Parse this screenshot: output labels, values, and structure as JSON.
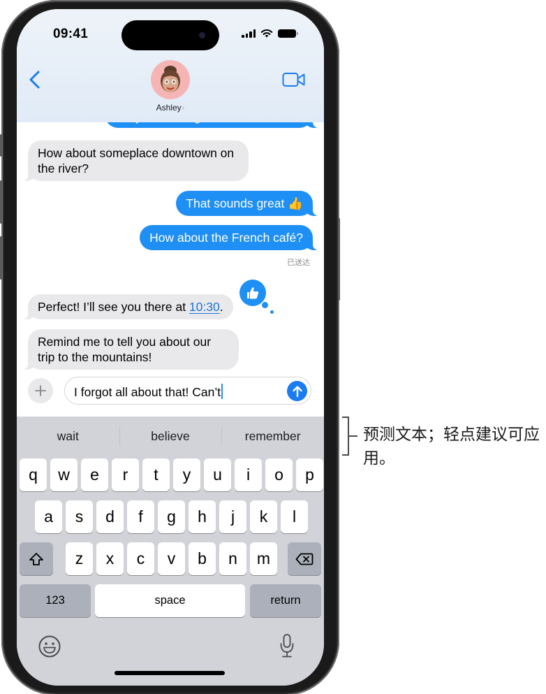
{
  "status_bar": {
    "time": "09:41",
    "icons": [
      "cellular-signal-icon",
      "wifi-icon",
      "battery-icon"
    ]
  },
  "header": {
    "back_icon": "chevron-left-icon",
    "contact_name": "Ashley",
    "contact_chevron": "›",
    "video_icon": "video-camera-icon"
  },
  "messages": [
    {
      "direction": "out",
      "text": "are you thinking?",
      "clipped": true
    },
    {
      "direction": "in",
      "text": "How about someplace downtown on the river?"
    },
    {
      "direction": "out",
      "text": "That sounds great 👍"
    },
    {
      "direction": "out",
      "text": "How about the French café?"
    },
    {
      "direction": "in",
      "text_before": "Perfect! I’ll see you there at ",
      "link": "10:30",
      "text_after": ".",
      "tapback": "thumbs-up"
    },
    {
      "direction": "in",
      "text": "Remind me to tell you about our trip to the mountains!"
    }
  ],
  "delivery_status": "已送达",
  "compose": {
    "value": "I forgot all about that! Can’t",
    "add_icon": "plus-icon",
    "send_icon": "arrow-up-icon"
  },
  "keyboard": {
    "predictions": [
      "wait",
      "believe",
      "remember"
    ],
    "row1": [
      "q",
      "w",
      "e",
      "r",
      "t",
      "y",
      "u",
      "i",
      "o",
      "p"
    ],
    "row2": [
      "a",
      "s",
      "d",
      "f",
      "g",
      "h",
      "j",
      "k",
      "l"
    ],
    "row3": [
      "z",
      "x",
      "c",
      "v",
      "b",
      "n",
      "m"
    ],
    "shift_icon": "shift-icon",
    "delete_icon": "delete-icon",
    "numbers_label": "123",
    "space_label": "space",
    "return_label": "return",
    "emoji_icon": "emoji-icon",
    "mic_icon": "microphone-icon"
  },
  "callout": {
    "text": "预测文本；轻点建议可应用。"
  },
  "colors": {
    "accent_blue": "#1e8ff5",
    "incoming_bubble": "#e9e9eb",
    "keyboard_bg": "#d1d3d9",
    "dark_key": "#abb0ba"
  }
}
